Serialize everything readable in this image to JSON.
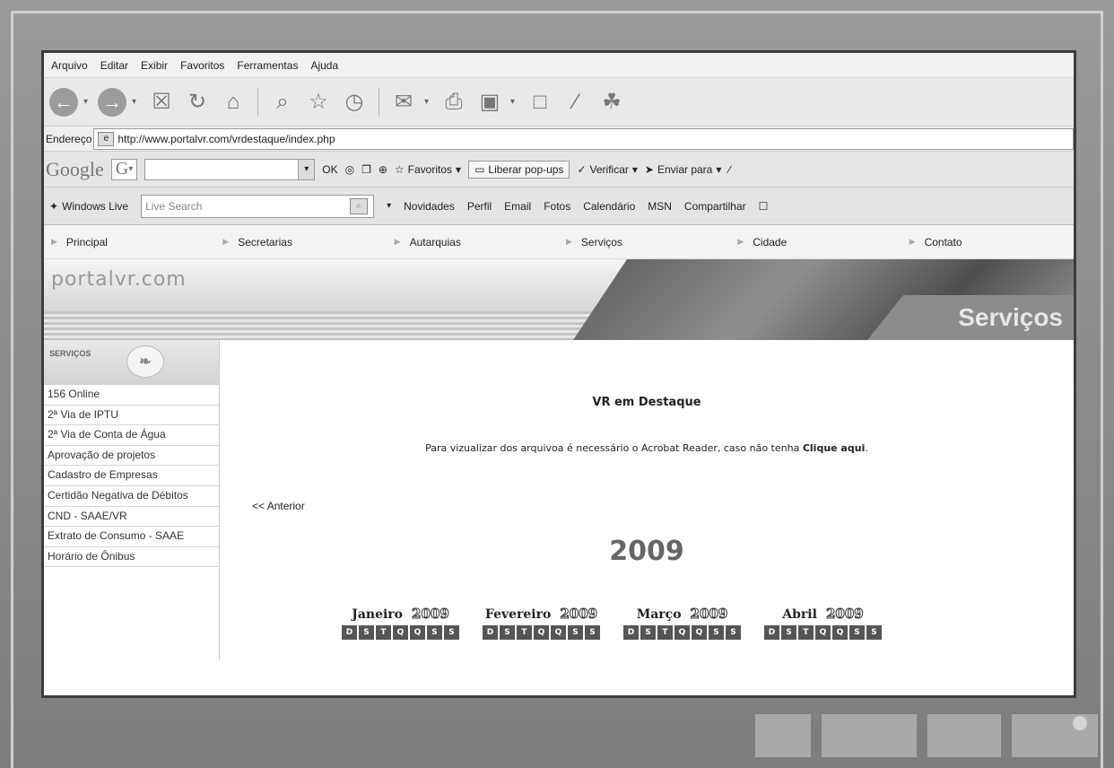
{
  "menubar": [
    "Arquivo",
    "Editar",
    "Exibir",
    "Favoritos",
    "Ferramentas",
    "Ajuda"
  ],
  "address": {
    "label": "Endereço",
    "url": "http://www.portalvr.com/vrdestaque/index.php"
  },
  "googlebar": {
    "logo": "Google",
    "g": "G",
    "ok": "OK",
    "favorites": "Favoritos",
    "popups": "Liberar pop-ups",
    "verify": "Verificar",
    "send": "Enviar para"
  },
  "livebar": {
    "brand": "Windows Live",
    "search_placeholder": "Live Search",
    "links": [
      "Novidades",
      "Perfil",
      "Email",
      "Fotos",
      "Calendário",
      "MSN",
      "Compartilhar"
    ]
  },
  "site": {
    "nav": [
      "Principal",
      "Secretarias",
      "Autarquias",
      "Serviços",
      "Cidade",
      "Contato"
    ],
    "logo": "portalvr.com",
    "section": "Serviços",
    "sidebar_title": "SERVIÇOS",
    "sidebar_items": [
      "156 Online",
      "2ª Via de IPTU",
      "2ª Via de Conta de Água",
      "Aprovação de projetos",
      "Cadastro de Empresas",
      "Certidão Negativa de Débitos",
      "CND - SAAE/VR",
      "Extrato de Consumo - SAAE",
      "Horário de Ônibus"
    ],
    "main_title": "VR em Destaque",
    "note_text": "Para vizualizar dos arquivoa é necessário o Acrobat Reader, caso não tenha",
    "note_link": "Clique aqui",
    "prev": "<< Anterior",
    "year": "2009",
    "months": [
      {
        "name": "Janeiro",
        "year": "2009"
      },
      {
        "name": "Fevereiro",
        "year": "2009"
      },
      {
        "name": "Março",
        "year": "2009"
      },
      {
        "name": "Abril",
        "year": "2009"
      }
    ],
    "weekdays": [
      "D",
      "S",
      "T",
      "Q",
      "Q",
      "S",
      "S"
    ]
  }
}
